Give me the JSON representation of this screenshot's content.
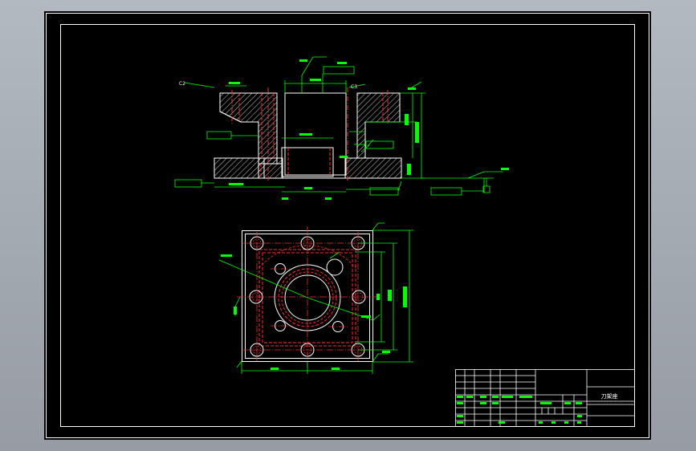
{
  "drawing": {
    "title_block": {
      "drawing_name": "刀架座"
    },
    "section_view": {
      "chamfer_left": "C2",
      "chamfer_right": "C3"
    },
    "colors": {
      "background": "#000000",
      "frame": "#ffffff",
      "outline": "#ffffff",
      "dimension": "#00ff00",
      "centerline": "#ff2a2a",
      "hidden_line": "#ff2a2a",
      "hatch": "#ffffff"
    }
  }
}
